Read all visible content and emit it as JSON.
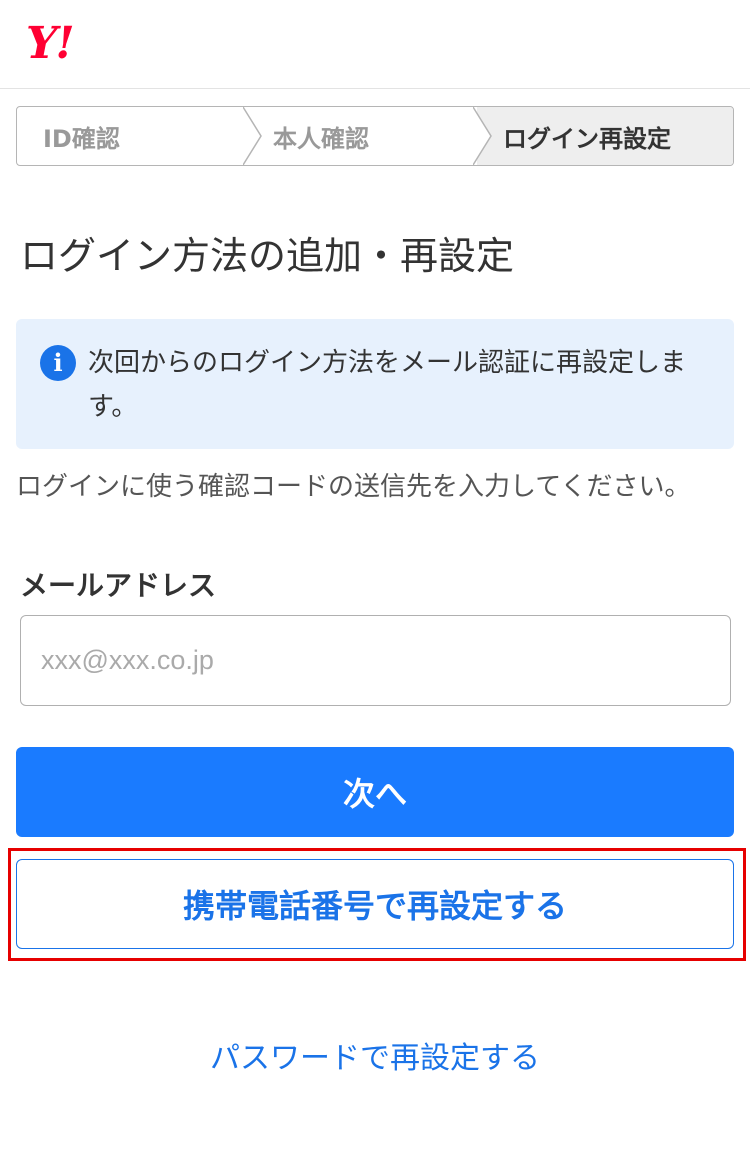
{
  "header": {
    "logo_text": "Y!"
  },
  "steps": [
    {
      "label": "ID確認",
      "state": "done"
    },
    {
      "label": "本人確認",
      "state": "done"
    },
    {
      "label": "ログイン再設定",
      "state": "current"
    }
  ],
  "page_title": "ログイン方法の追加・再設定",
  "notice": {
    "icon": "info-icon",
    "icon_glyph": "i",
    "text": "次回からのログイン方法をメール認証に再設定します。"
  },
  "instruction": "ログインに使う確認コードの送信先を入力してください。",
  "email_field": {
    "label": "メールアドレス",
    "value": "",
    "placeholder": "xxx@xxx.co.jp"
  },
  "buttons": {
    "next_label": "次へ",
    "phone_reset_label": "携帯電話番号で再設定する"
  },
  "links": {
    "password_reset_label": "パスワードで再設定する"
  },
  "colors": {
    "brand_red": "#ff0033",
    "primary_blue": "#1a7bff",
    "link_blue": "#1a73e8",
    "notice_bg": "#e7f1fd",
    "highlight_red": "#e60000"
  }
}
